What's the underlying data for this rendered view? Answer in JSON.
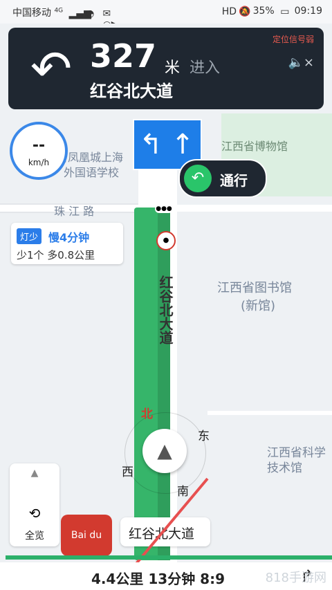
{
  "status": {
    "carrier": "中国移动",
    "net": "4G",
    "battery": "35%",
    "time": "09:19"
  },
  "banner": {
    "distance": "327",
    "unit": "米",
    "action": "进入",
    "street": "红谷北大道",
    "signal_weak": "定位信号弱"
  },
  "speed": {
    "value": "--",
    "unit": "km/h"
  },
  "map": {
    "labels": [
      "省凤凰城上海",
      "外国语学校",
      "珠 江 路",
      "江西省博物馆",
      "江西省图书馆",
      "(新馆)",
      "江西省科学",
      "技术馆"
    ],
    "road_vertical": "红谷北大道",
    "dir_north": "北",
    "dir_east": "东",
    "dir_west": "西",
    "dir_south": "南"
  },
  "pass": {
    "label": "通行"
  },
  "light": {
    "tag": "灯少",
    "slow": "慢4分钟",
    "extra": "少1个 多0.8公里"
  },
  "controls": {
    "overview": "全览"
  },
  "street_tag": "红谷北大道",
  "bottom": {
    "eta": "4.4公里 13分钟 8:9",
    "watermark": "818手游网"
  }
}
